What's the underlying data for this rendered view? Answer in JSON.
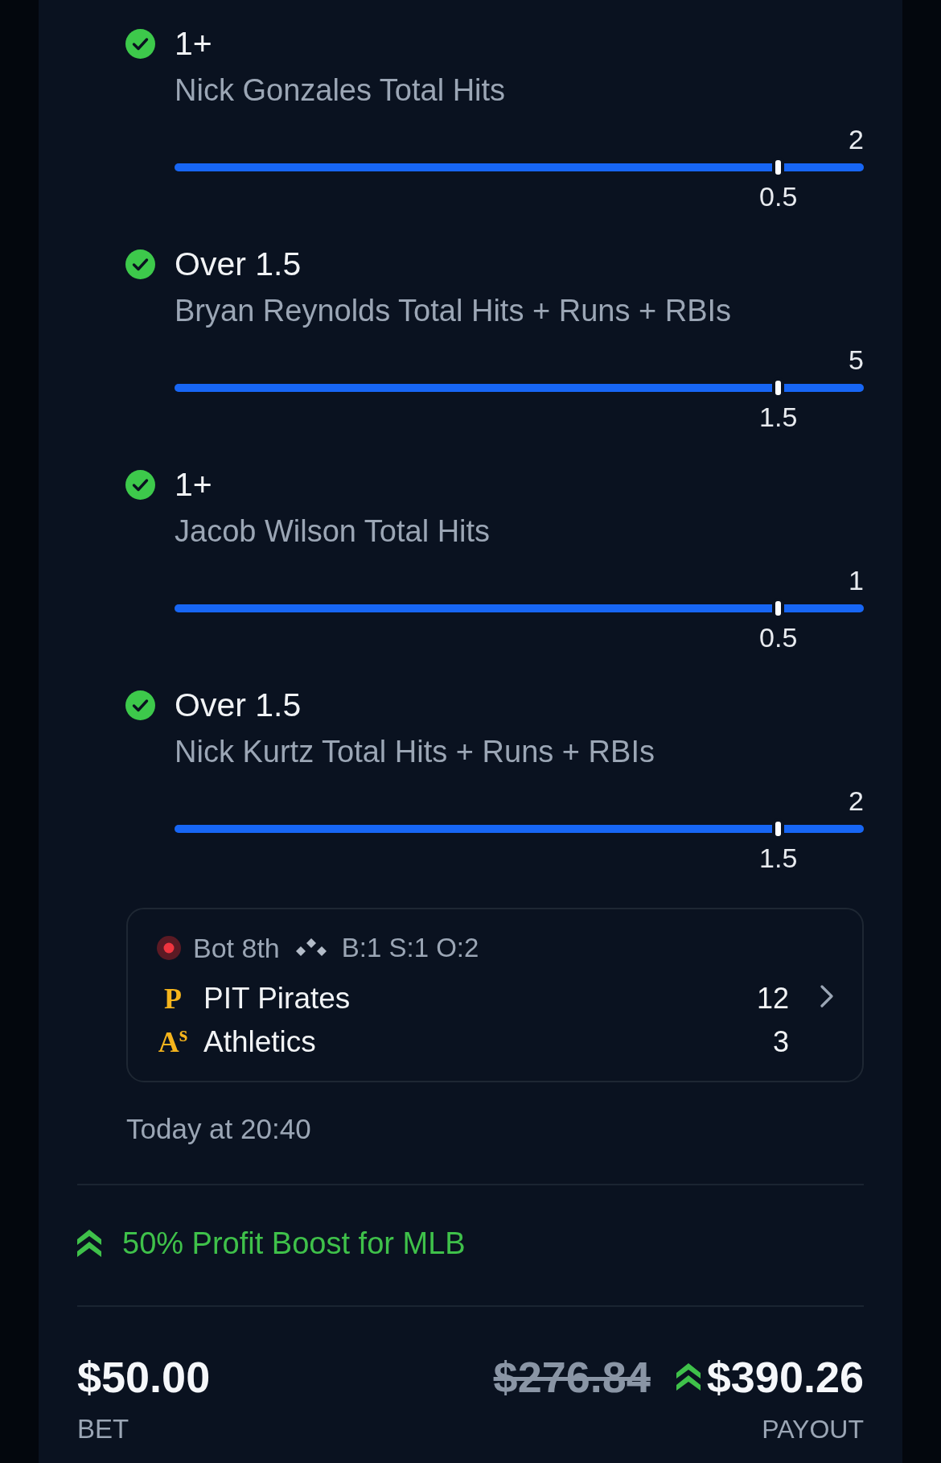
{
  "legs": [
    {
      "won": true,
      "selection": "1+",
      "market": "Nick Gonzales Total Hits",
      "result": "2",
      "line": "0.5",
      "level": 1
    },
    {
      "won": true,
      "selection": "Over 1.5",
      "market": "Bryan Reynolds Total Hits + Runs + RBIs",
      "result": "5",
      "line": "1.5",
      "level": 1
    },
    {
      "won": true,
      "selection": "1+",
      "market": "Jacob Wilson Total Hits",
      "result": "1",
      "line": "0.5",
      "level": 1
    },
    {
      "won": true,
      "selection": "Over 1.5",
      "market": "Nick Kurtz Total Hits + Runs + RBIs",
      "result": "2",
      "line": "1.5",
      "level": 1
    }
  ],
  "game": {
    "live": true,
    "inning": "Bot 8th",
    "count": "B:1 S:1 O:2",
    "teams": [
      {
        "logo": "P",
        "name": "PIT Pirates",
        "score": "12"
      },
      {
        "logo": "A$^{s}$",
        "name": "Athletics",
        "score": "3"
      }
    ]
  },
  "start_time": "Today at 20:40",
  "promo": {
    "label": "50% Profit Boost for MLB"
  },
  "wager": {
    "amount": "$50.00",
    "label": "BET"
  },
  "payout": {
    "original": "$276.84",
    "boosted": "$390.26",
    "label": "PAYOUT"
  }
}
